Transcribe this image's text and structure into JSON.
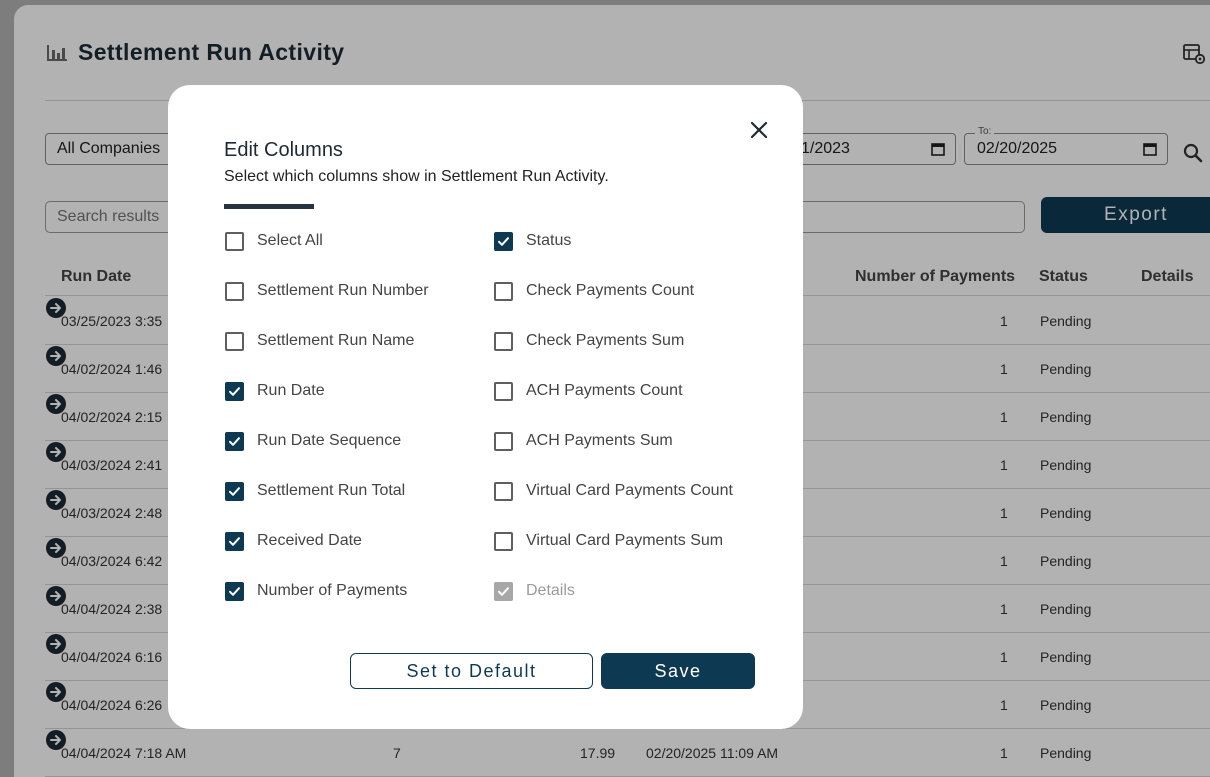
{
  "page": {
    "title": "Settlement Run Activity",
    "company_select": "All Companies",
    "date_from": {
      "value": "1/2023"
    },
    "date_to": {
      "legend": "To:",
      "value": "02/20/2025"
    },
    "search_placeholder": "Search results",
    "export_label": "Export"
  },
  "table": {
    "headers": {
      "run_date": "Run Date",
      "number_of_payments": "Number of Payments",
      "status": "Status",
      "details": "Details"
    },
    "rows": [
      {
        "run_date": "03/25/2023 3:35",
        "payments": "1",
        "status": "Pending"
      },
      {
        "run_date": "04/02/2024 1:46",
        "payments": "1",
        "status": "Pending"
      },
      {
        "run_date": "04/02/2024 2:15",
        "payments": "1",
        "status": "Pending"
      },
      {
        "run_date": "04/03/2024 2:41",
        "payments": "1",
        "status": "Pending"
      },
      {
        "run_date": "04/03/2024 2:48",
        "payments": "1",
        "status": "Pending"
      },
      {
        "run_date": "04/03/2024 6:42",
        "payments": "1",
        "status": "Pending"
      },
      {
        "run_date": "04/04/2024 2:38",
        "payments": "1",
        "status": "Pending"
      },
      {
        "run_date": "04/04/2024 6:16",
        "payments": "1",
        "status": "Pending"
      },
      {
        "run_date": "04/04/2024 6:26",
        "payments": "1",
        "status": "Pending"
      },
      {
        "run_date": "04/04/2024 7:18 AM",
        "sequence": "7",
        "total": "17.99",
        "received": "02/20/2025 11:09 AM",
        "payments": "1",
        "status": "Pending"
      }
    ]
  },
  "modal": {
    "title": "Edit Columns",
    "subtitle": "Select which columns show in Settlement Run Activity.",
    "left_options": [
      {
        "label": "Select All",
        "checked": false
      },
      {
        "label": "Settlement Run Number",
        "checked": false
      },
      {
        "label": "Settlement Run Name",
        "checked": false
      },
      {
        "label": "Run Date",
        "checked": true
      },
      {
        "label": "Run Date Sequence",
        "checked": true
      },
      {
        "label": "Settlement Run Total",
        "checked": true
      },
      {
        "label": "Received Date",
        "checked": true
      },
      {
        "label": "Number of Payments",
        "checked": true
      }
    ],
    "right_options": [
      {
        "label": "Status",
        "checked": true
      },
      {
        "label": "Check Payments Count",
        "checked": false
      },
      {
        "label": "Check Payments Sum",
        "checked": false
      },
      {
        "label": "ACH Payments Count",
        "checked": false
      },
      {
        "label": "ACH Payments Sum",
        "checked": false
      },
      {
        "label": "Virtual Card Payments Count",
        "checked": false
      },
      {
        "label": "Virtual Card Payments Sum",
        "checked": false
      },
      {
        "label": "Details",
        "checked": true,
        "disabled": true
      }
    ],
    "set_default_label": "Set to Default",
    "save_label": "Save"
  },
  "colors": {
    "primary": "#0d3a52",
    "overlay": "rgba(0,0,0,0.30)"
  }
}
